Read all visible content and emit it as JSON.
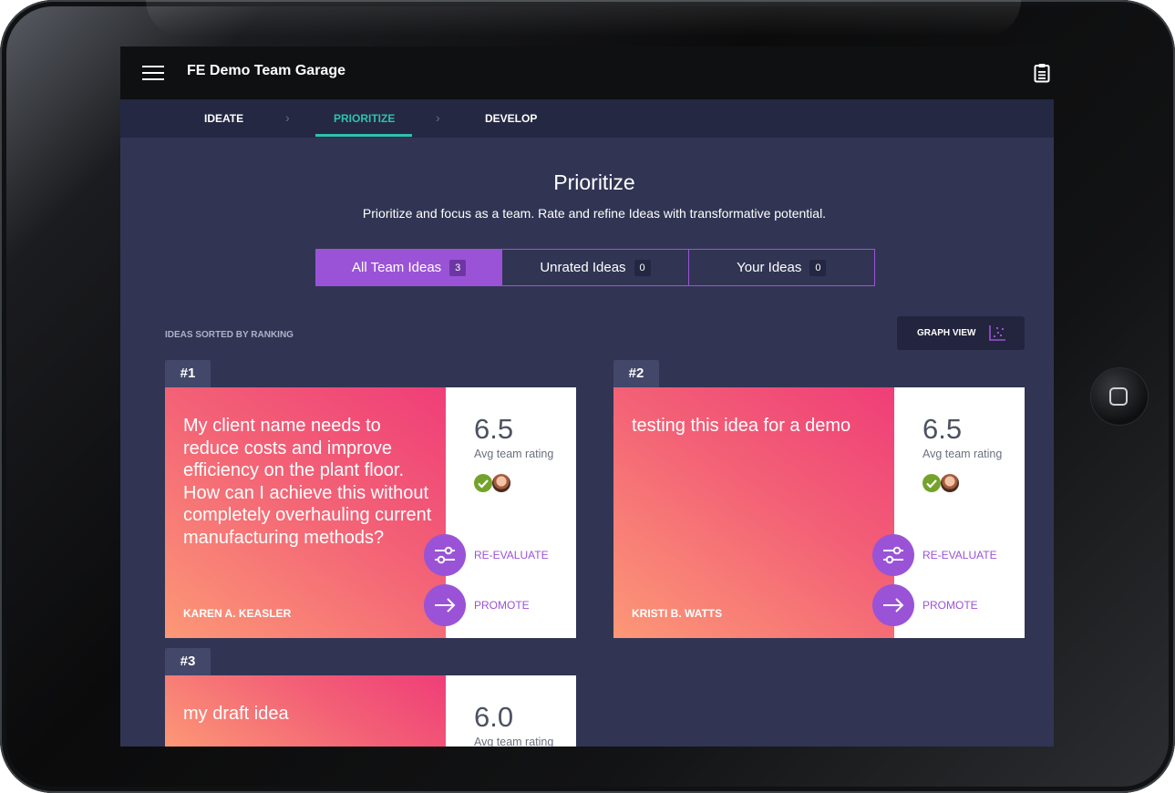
{
  "app": {
    "title": "FE Demo Team Garage"
  },
  "steps": [
    {
      "label": "IDEATE",
      "active": false
    },
    {
      "label": "PRIORITIZE",
      "active": true
    },
    {
      "label": "DEVELOP",
      "active": false
    }
  ],
  "page": {
    "title": "Prioritize",
    "subtitle": "Prioritize and focus as a team. Rate and refine Ideas with transformative potential."
  },
  "filters": [
    {
      "label": "All Team Ideas",
      "count": "3",
      "active": true
    },
    {
      "label": "Unrated Ideas",
      "count": "0",
      "active": false
    },
    {
      "label": "Your Ideas",
      "count": "0",
      "active": false
    }
  ],
  "list": {
    "sorted_label": "IDEAS SORTED BY RANKING",
    "graph_view_label": "GRAPH VIEW"
  },
  "ideas": [
    {
      "rank": "#1",
      "title": "My client name needs to reduce costs and improve efficiency on the plant floor. How can I achieve this without completely overhauling current manufacturing methods?",
      "author": "KAREN A. KEASLER",
      "rating": "6.5",
      "rating_label": "Avg team rating",
      "reevaluate_label": "RE-EVALUATE",
      "promote_label": "PROMOTE"
    },
    {
      "rank": "#2",
      "title": "testing this idea for a demo",
      "author": "KRISTI B. WATTS",
      "rating": "6.5",
      "rating_label": "Avg team rating",
      "reevaluate_label": "RE-EVALUATE",
      "promote_label": "PROMOTE"
    },
    {
      "rank": "#3",
      "title": "my draft idea",
      "author": "",
      "rating": "6.0",
      "rating_label": "Avg team rating",
      "reevaluate_label": "",
      "promote_label": ""
    }
  ],
  "icons": {
    "menu": "hamburger-icon",
    "clipboard": "clipboard-icon",
    "graph": "scatter-graph-icon",
    "reevaluate": "sliders-icon",
    "promote": "arrow-right-icon",
    "rated": "check-icon"
  },
  "colors": {
    "accent_purple": "#9a53d6",
    "accent_teal": "#2fc2ad",
    "screen_background": "#313553",
    "card_gradient_start": "#ef3e78",
    "card_gradient_end": "#fc9876"
  }
}
